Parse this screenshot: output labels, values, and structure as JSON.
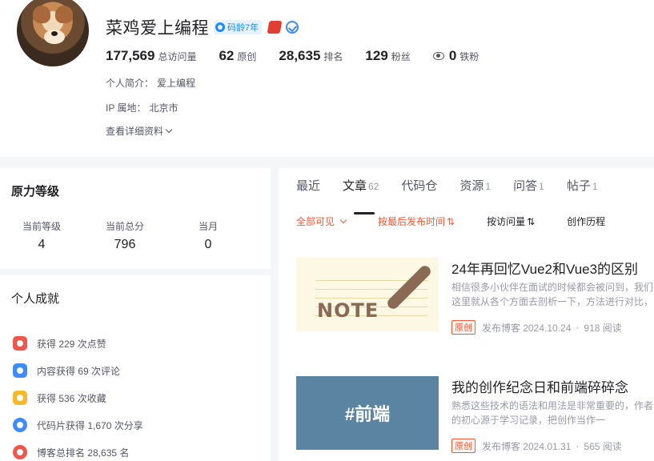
{
  "profile": {
    "username": "菜鸡爱上编程",
    "age_badge": "码龄7年",
    "stats": [
      {
        "num": "177,569",
        "label": "总访问量"
      },
      {
        "num": "62",
        "label": "原创"
      },
      {
        "num": "28,635",
        "label": "排名"
      },
      {
        "num": "129",
        "label": "粉丝"
      }
    ],
    "iron_fans": {
      "num": "0",
      "label": "铁粉"
    },
    "bio_label": "个人简介：",
    "bio_value": "爱上编程",
    "ip_label": "IP 属地：",
    "ip_value": "北京市",
    "more_info": "查看详细资料"
  },
  "level_panel": {
    "title": "原力等级",
    "cols": [
      {
        "label": "当前等级",
        "value": "4"
      },
      {
        "label": "当前总分",
        "value": "796"
      },
      {
        "label": "当月",
        "value": "0"
      }
    ]
  },
  "achievements": {
    "title": "个人成就",
    "items": [
      {
        "text": "获得 229 次点赞",
        "icon": "thumb-up-icon",
        "color": "#f0574a"
      },
      {
        "text": "内容获得 69 次评论",
        "icon": "comment-icon",
        "color": "#3d8bff"
      },
      {
        "text": "获得 536 次收藏",
        "icon": "star-icon",
        "color": "#f8b82c"
      },
      {
        "text": "代码片获得 1,670 次分享",
        "icon": "share-icon",
        "color": "#3d8bff"
      },
      {
        "text": "博客总排名 28,635 名",
        "icon": "rank-icon",
        "color": "#f0574a"
      }
    ]
  },
  "tabs": [
    {
      "label": "最近",
      "count": ""
    },
    {
      "label": "文章",
      "count": "62"
    },
    {
      "label": "代码仓",
      "count": ""
    },
    {
      "label": "资源",
      "count": "1"
    },
    {
      "label": "问答",
      "count": "1"
    },
    {
      "label": "帖子",
      "count": "1"
    }
  ],
  "filters": {
    "visibility": "全部可见",
    "sort_time": "按最后发布时间",
    "sort_views": "按访问量",
    "history": "创作历程"
  },
  "articles": [
    {
      "title": "24年再回忆Vue2和Vue3的区别",
      "desc": "相信很多小伙伴在面试的时候都会被问到，我们这里就从各个方面去剖析一下，方法进行对比，但是很难从各个方面去剖析",
      "original": "原创",
      "date": "发布博客 2024.10.24",
      "views": "918 阅读",
      "thumb_text": "NOTE"
    },
    {
      "title": "我的创作纪念日和前端碎碎念",
      "desc": "熟悉这些技术的语法和用法是非常重要的，作者的初心源于学习记录，把创作当作一",
      "original": "原创",
      "date": "发布博客 2024.01.31",
      "views": "565 阅读",
      "thumb_text": "#前端"
    }
  ],
  "colors": {
    "accent_red": "#fc5531",
    "brand_blue": "#1a8bff"
  }
}
